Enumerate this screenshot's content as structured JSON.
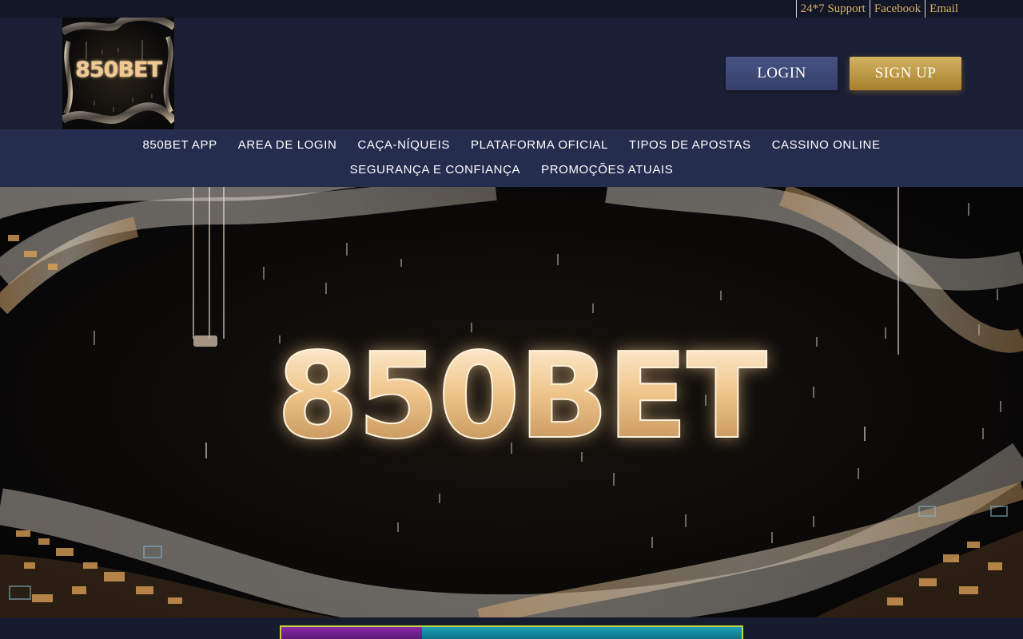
{
  "topbar": {
    "links": [
      {
        "label": "24*7 Support"
      },
      {
        "label": "Facebook"
      },
      {
        "label": "Email"
      }
    ]
  },
  "header": {
    "logo_text": "850BET",
    "login_label": "LOGIN",
    "signup_label": "SIGN UP"
  },
  "nav": {
    "items": [
      {
        "label": "850BET APP"
      },
      {
        "label": "AREA DE LOGIN"
      },
      {
        "label": "CAÇA-NÍQUEIS"
      },
      {
        "label": "PLATAFORMA OFICIAL"
      },
      {
        "label": "TIPOS DE APOSTAS"
      },
      {
        "label": "CASSINO ONLINE"
      },
      {
        "label": "SEGURANÇA E CONFIANÇA"
      },
      {
        "label": "PROMOÇÕES ATUAIS"
      }
    ]
  },
  "hero": {
    "banner_text": "850BET"
  },
  "colors": {
    "topbar_bg": "#121627",
    "header_bg": "#1b1f36",
    "nav_bg": "#252d4f",
    "accent_gold": "#d8b062",
    "login_button": "#3f4a78",
    "signup_button": "#c09a45"
  }
}
